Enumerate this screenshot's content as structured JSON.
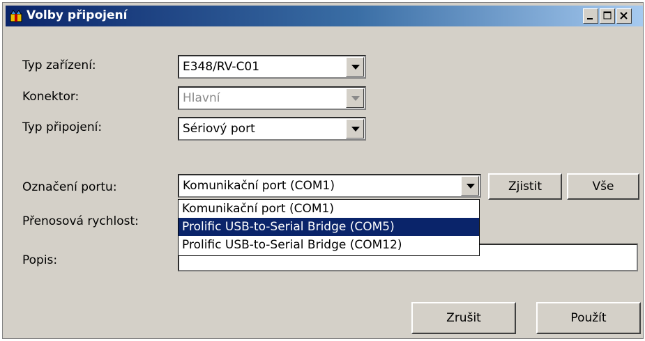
{
  "window": {
    "title": "Volby připojení"
  },
  "form": {
    "device_type": {
      "label": "Typ zařízení:",
      "value": "E348/RV-C01"
    },
    "connector": {
      "label": "Konektor:",
      "value": "Hlavní"
    },
    "connection_type": {
      "label": "Typ připojení:",
      "value": "Sériový port"
    },
    "port": {
      "label": "Označení portu:",
      "value": "Komunikační port (COM1)",
      "options": [
        "Komunikační port (COM1)",
        "Prolific USB-to-Serial Bridge (COM5)",
        "Prolific USB-to-Serial Bridge (COM12)"
      ],
      "highlighted_option": "Prolific USB-to-Serial Bridge (COM5)"
    },
    "baud_rate": {
      "label": "Přenosová rychlost:"
    },
    "description": {
      "label": "Popis:",
      "value": ""
    }
  },
  "buttons": {
    "detect": "Zjistit",
    "all": "Vše",
    "cancel": "Zrušit",
    "apply": "Použít"
  },
  "colors": {
    "title_start": "#0a246a",
    "title_end": "#a6caf0",
    "selection": "#0a246a",
    "face": "#d4d0c8"
  }
}
